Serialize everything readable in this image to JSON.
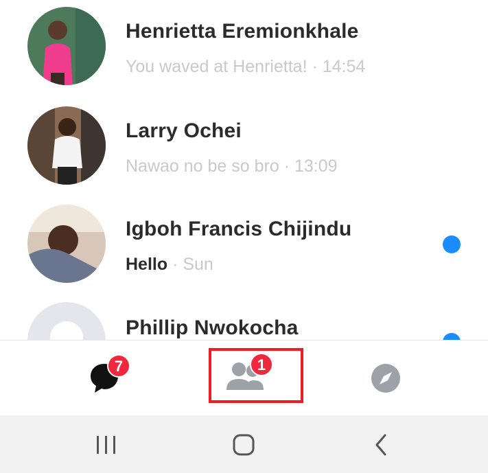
{
  "chats": [
    {
      "name": "Henrietta Eremionkhale",
      "preview_bold": "",
      "preview": "You waved at Henrietta! · 14:54",
      "unread": false
    },
    {
      "name": "Larry Ochei",
      "preview_bold": "",
      "preview": "Nawao no be so bro · 13:09",
      "unread": false
    },
    {
      "name": "Igboh Francis Chijindu",
      "preview_bold": "Hello",
      "preview": " · Sun",
      "unread": true
    },
    {
      "name": "Phillip Nwokocha",
      "preview_bold": "",
      "preview": "",
      "unread": true
    }
  ],
  "tabs": {
    "chats_badge": "7",
    "people_badge": "1"
  },
  "colors": {
    "accent": "#1a8cff",
    "badge": "#f0283e",
    "highlight": "#ef1c25"
  },
  "icons": {
    "chats": "chat-bubble-icon",
    "people": "people-icon",
    "discover": "compass-icon",
    "recents": "recent-apps-icon",
    "home": "home-icon",
    "back": "back-icon"
  }
}
